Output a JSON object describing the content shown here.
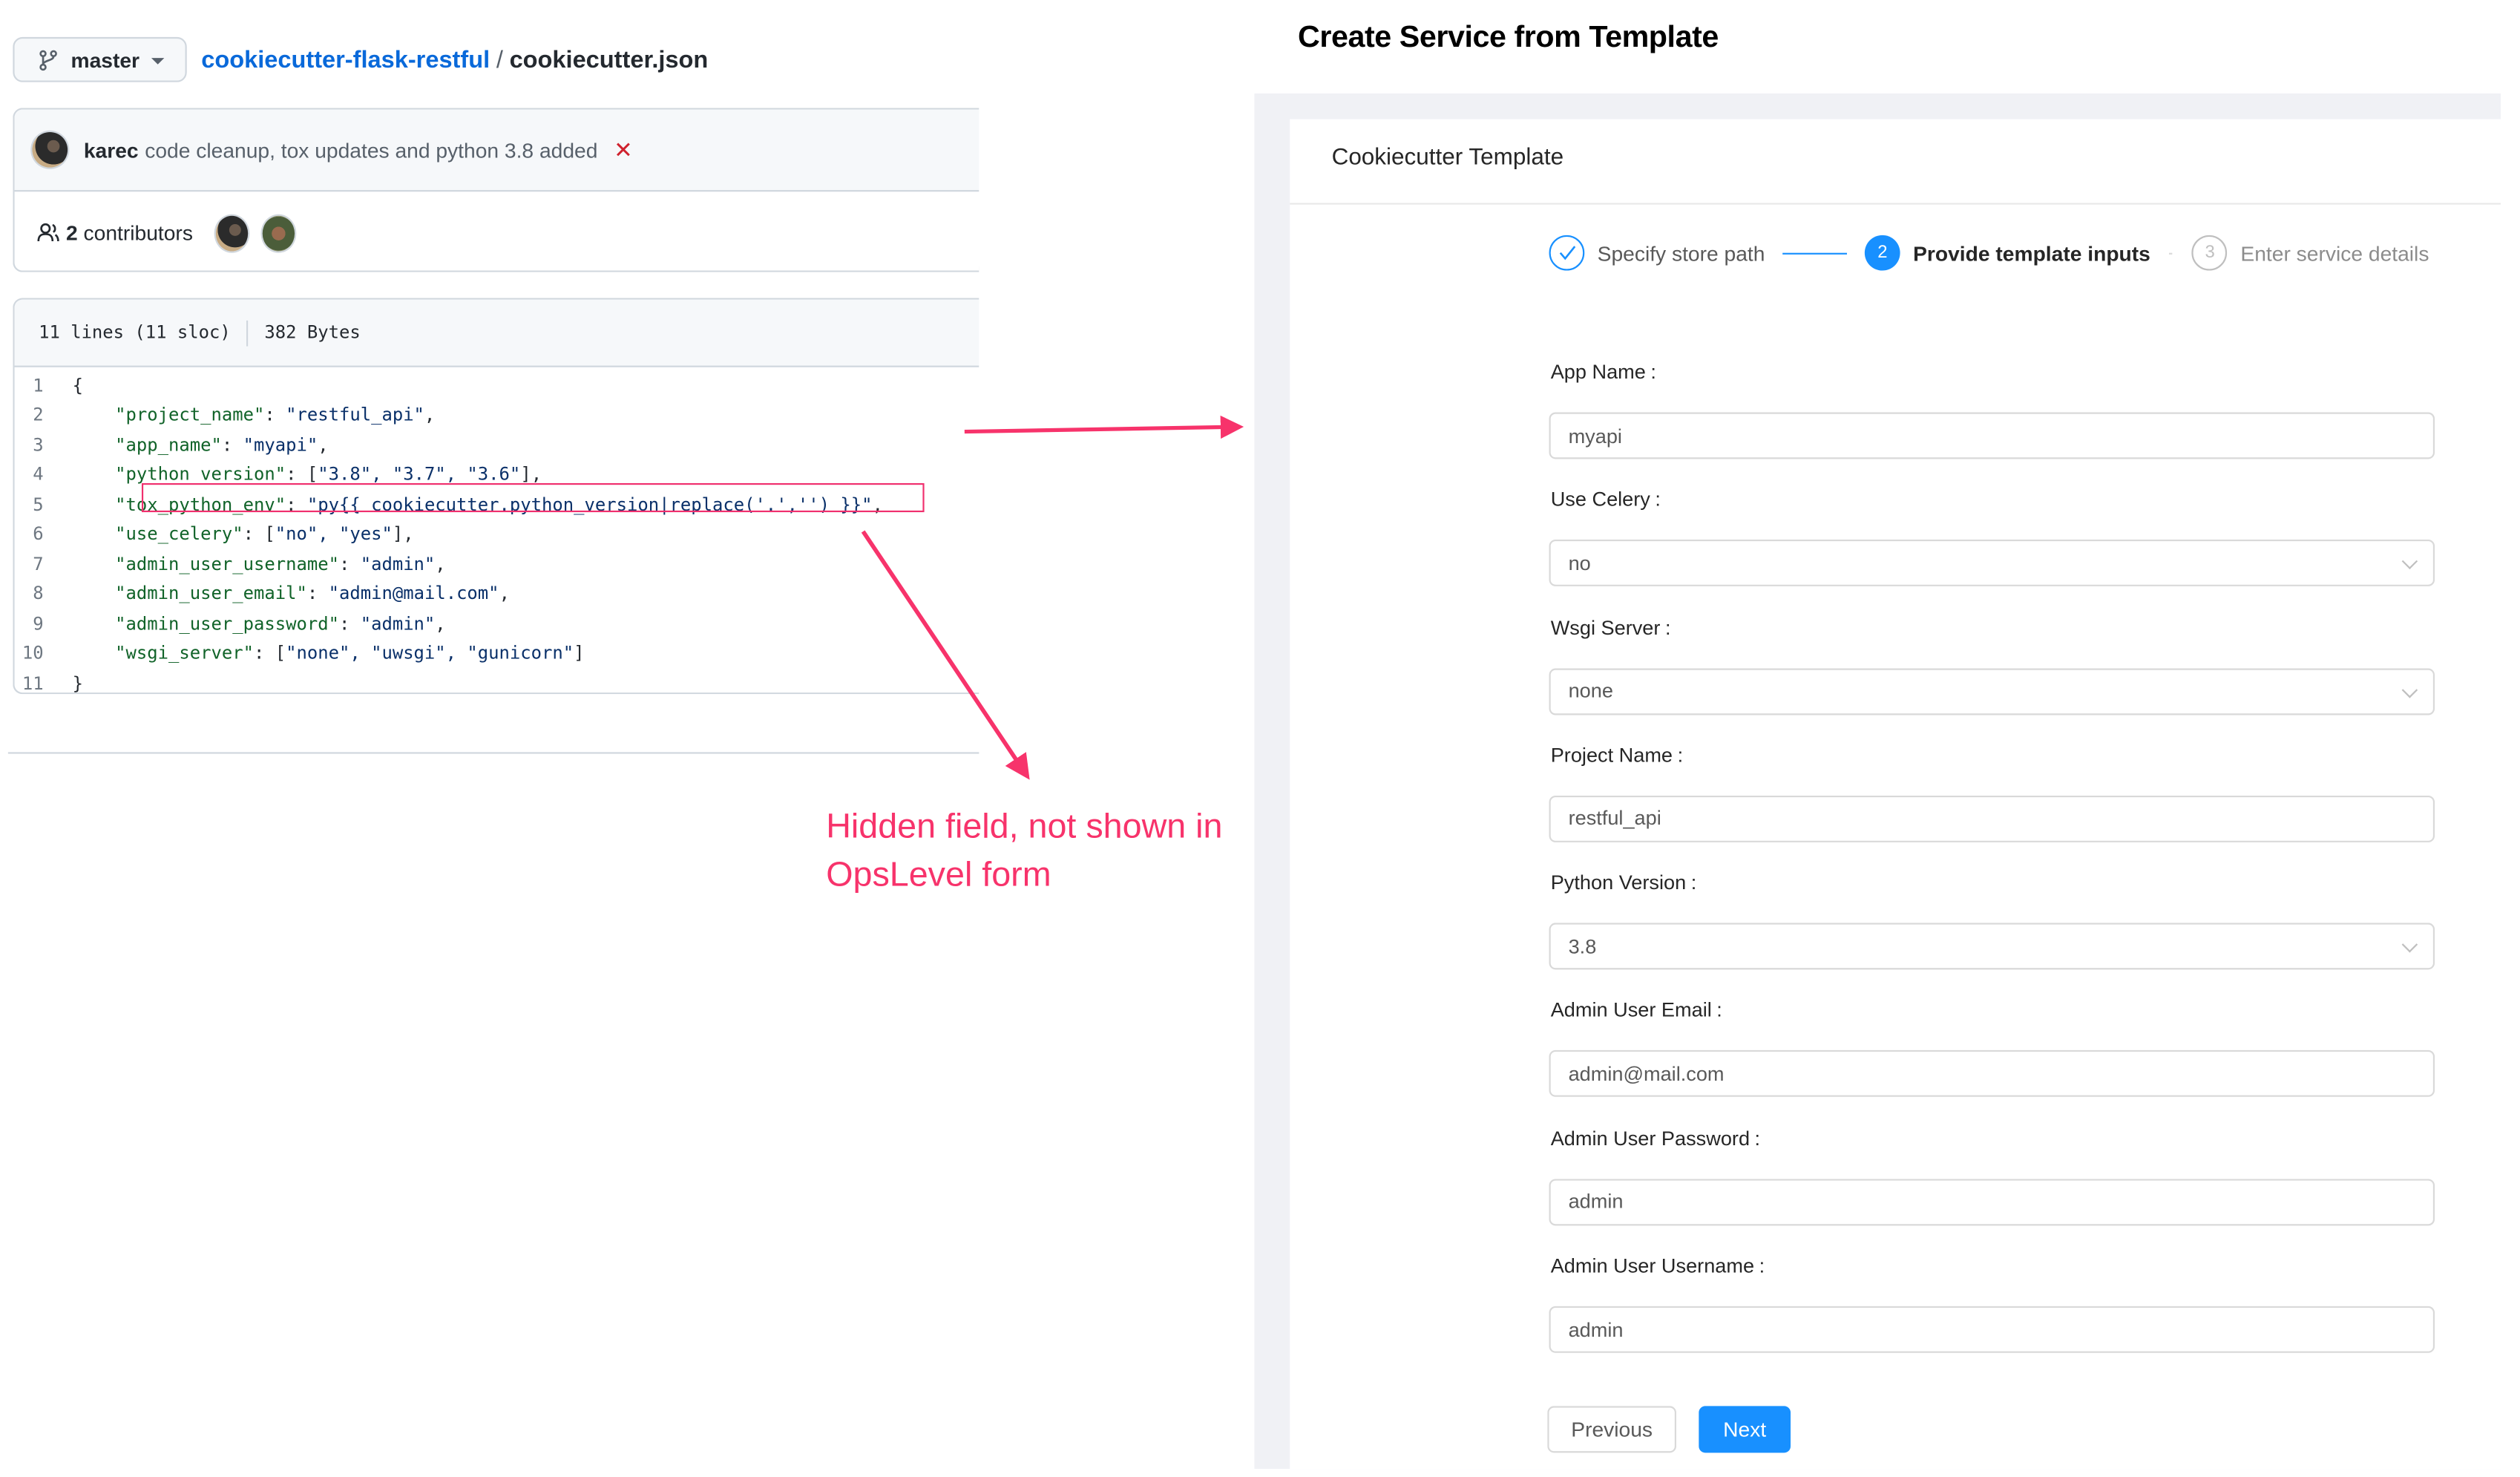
{
  "github": {
    "branch": "master",
    "repo": "cookiecutter-flask-restful",
    "separator": "/",
    "file": "cookiecutter.json",
    "commit": {
      "author": "karec",
      "message": "code cleanup, tox updates and python 3.8 added",
      "status_icon": "x-fail-icon",
      "status_glyph": "✕"
    },
    "contributors": {
      "count": "2",
      "label": "contributors"
    },
    "file_info": {
      "lines": "11 lines (11 sloc)",
      "size": "382 Bytes"
    },
    "code": [
      {
        "n": "1",
        "indent": "",
        "key": "",
        "rest": "{"
      },
      {
        "n": "2",
        "indent": "    ",
        "key": "\"project_name\"",
        "rest": ": ",
        "val": "\"restful_api\"",
        "end": ","
      },
      {
        "n": "3",
        "indent": "    ",
        "key": "\"app_name\"",
        "rest": ": ",
        "val": "\"myapi\"",
        "end": ","
      },
      {
        "n": "4",
        "indent": "    ",
        "key": "\"python_version\"",
        "rest": ": [",
        "val": "\"3.8\", \"3.7\", \"3.6\"",
        "end": "],"
      },
      {
        "n": "5",
        "indent": "    ",
        "key": "\"tox_python_env\"",
        "rest": ": ",
        "val": "\"py{{ cookiecutter.python_version|replace('.','') }}\"",
        "end": ","
      },
      {
        "n": "6",
        "indent": "    ",
        "key": "\"use_celery\"",
        "rest": ": [",
        "val": "\"no\", \"yes\"",
        "end": "],"
      },
      {
        "n": "7",
        "indent": "    ",
        "key": "\"admin_user_username\"",
        "rest": ": ",
        "val": "\"admin\"",
        "end": ","
      },
      {
        "n": "8",
        "indent": "    ",
        "key": "\"admin_user_email\"",
        "rest": ": ",
        "val": "\"admin@mail.com\"",
        "end": ","
      },
      {
        "n": "9",
        "indent": "    ",
        "key": "\"admin_user_password\"",
        "rest": ": ",
        "val": "\"admin\"",
        "end": ","
      },
      {
        "n": "10",
        "indent": "    ",
        "key": "\"wsgi_server\"",
        "rest": ": [",
        "val": "\"none\", \"uwsgi\", \"gunicorn\"",
        "end": "]"
      },
      {
        "n": "11",
        "indent": "",
        "key": "",
        "rest": "}"
      }
    ],
    "highlighted_line": "5"
  },
  "annotation": {
    "text": "Hidden field, not shown in OpsLevel form",
    "color": "#f7336b"
  },
  "opslevel": {
    "page_title": "Create Service from Template",
    "card_title": "Cookiecutter Template",
    "steps": [
      {
        "number": "1",
        "label": "Specify store path",
        "status": "done"
      },
      {
        "number": "2",
        "label": "Provide template inputs",
        "status": "active"
      },
      {
        "number": "3",
        "label": "Enter service details",
        "status": "wait"
      }
    ],
    "fields": [
      {
        "label": "App Name",
        "value": "myapi",
        "type": "text"
      },
      {
        "label": "Use Celery",
        "value": "no",
        "type": "select"
      },
      {
        "label": "Wsgi Server",
        "value": "none",
        "type": "select"
      },
      {
        "label": "Project Name",
        "value": "restful_api",
        "type": "text"
      },
      {
        "label": "Python Version",
        "value": "3.8",
        "type": "select"
      },
      {
        "label": "Admin User Email",
        "value": "admin@mail.com",
        "type": "text"
      },
      {
        "label": "Admin User Password",
        "value": "admin",
        "type": "text"
      },
      {
        "label": "Admin User Username",
        "value": "admin",
        "type": "text"
      }
    ],
    "buttons": {
      "previous": "Previous",
      "next": "Next"
    },
    "accent_color": "#1890ff"
  }
}
